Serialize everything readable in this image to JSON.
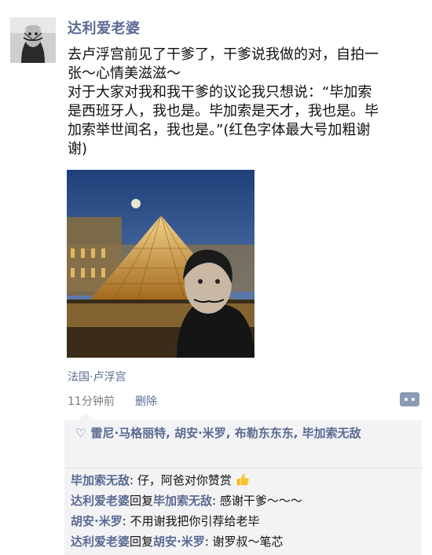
{
  "author": {
    "name": "达利爱老婆",
    "avatar_icon": "mustache-man-avatar-icon"
  },
  "post": {
    "line1": "去卢浮宫前见了干爹了，干爹说我做的对，自拍一张～心情美滋滋～",
    "line2": "对于大家对我和我干爹的议论我只想说：“毕加索是西班牙人，我也是。毕加索是天才，我也是。毕加索举世闻名，我也是。”(红色字体最大号加粗谢谢)"
  },
  "photo": {
    "icon": "louvre-pyramid-selfie-photo"
  },
  "meta": {
    "location": "法国·卢浮宫",
    "time": "11分钟前",
    "delete": "删除",
    "more_icon": "comment-more-icon"
  },
  "likes": {
    "icon": "heart-icon",
    "names": "雷尼·马格丽特, 胡安·米罗, 布勒东东东, 毕加索无敌"
  },
  "comments": [
    {
      "name": "毕加索无敌",
      "text": ": 仔，阿爸对你赞赏",
      "emoji": "thumbs-up-icon"
    },
    {
      "name": "达利爱老婆",
      "reply_word": "回复",
      "reply_to": "毕加索无敌",
      "text": ": 感谢干爹～～～"
    },
    {
      "name": "胡安·米罗",
      "text": ": 不用谢我把你引荐给老毕"
    },
    {
      "name": "达利爱老婆",
      "reply_word": "回复",
      "reply_to": "胡安·米罗",
      "text": ": 谢罗叔～笔芯"
    }
  ],
  "colors": {
    "name_blue": "#5a6a92",
    "panel_bg": "#f3f3f5",
    "text": "#111111"
  }
}
